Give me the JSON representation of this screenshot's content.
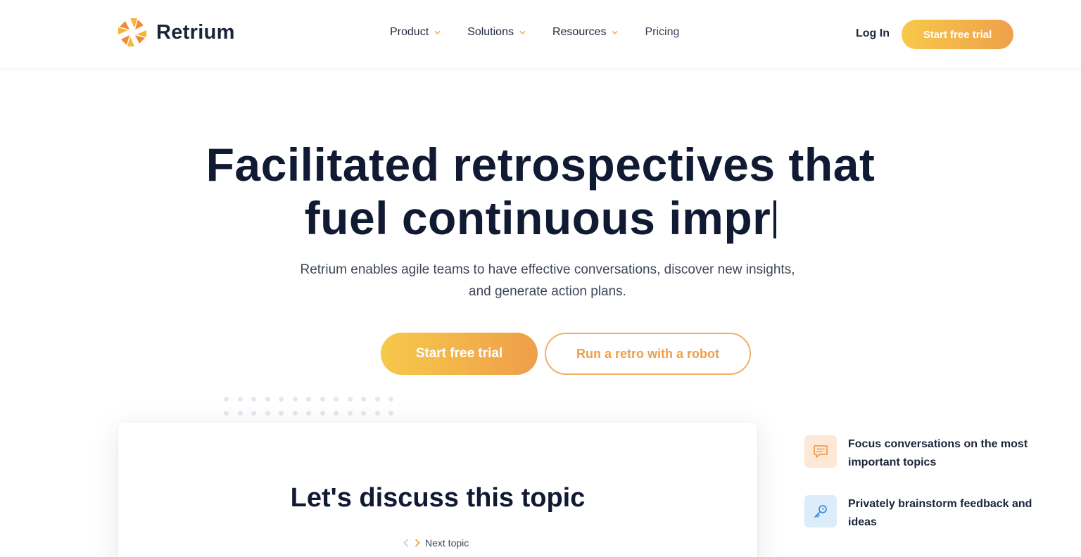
{
  "brand": {
    "name": "Retrium",
    "colors": {
      "accent_start": "#f7c94a",
      "accent_end": "#ef9e4a",
      "text_dark": "#111a33"
    }
  },
  "nav": {
    "items": [
      {
        "label": "Product",
        "has_dropdown": true
      },
      {
        "label": "Solutions",
        "has_dropdown": true
      },
      {
        "label": "Resources",
        "has_dropdown": true
      },
      {
        "label": "Pricing",
        "has_dropdown": false
      }
    ],
    "login_label": "Log In",
    "cta_label": "Start free trial"
  },
  "hero": {
    "title_line1": "Facilitated retrospectives that",
    "title_line2": "fuel continuous impr",
    "subtitle": "Retrium enables agile teams to have effective conversations, discover new insights, and generate action plans.",
    "primary_cta": "Start free trial",
    "secondary_cta": "Run a retro with a robot"
  },
  "preview_card": {
    "title": "Let's discuss this topic",
    "next_label": "Next topic"
  },
  "features": [
    {
      "icon": "chat-icon",
      "text": "Focus conversations on the most important topics"
    },
    {
      "icon": "key-icon",
      "text": "Privately brainstorm feedback and ideas"
    }
  ]
}
